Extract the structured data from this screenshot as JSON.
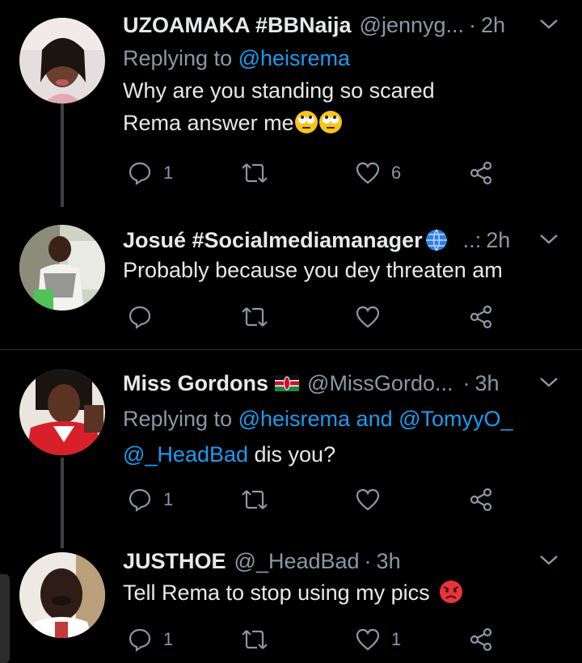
{
  "tweets": [
    {
      "name": "UZOAMAKA #BBNaija",
      "handle": "@jennyg...",
      "time": "2h",
      "replying_prefix": "Replying to ",
      "replying_mentions": "@heisrema",
      "lines": [
        "Why are you standing so scared",
        "Rema answer me"
      ],
      "emoji": [
        "face-with-rolling-eyes",
        "face-with-rolling-eyes"
      ],
      "reply_count": "1",
      "retweet_count": "",
      "like_count": "6"
    },
    {
      "name": "Josué #Socialmediamanager",
      "name_emoji": "globe",
      "handle": "..",
      "time": "2h",
      "lines": [
        "Probably because you dey threaten am"
      ],
      "reply_count": "",
      "retweet_count": "",
      "like_count": ""
    },
    {
      "name": "Miss Gordons",
      "name_emoji": "kenya-flag",
      "handle": "@MissGordo...",
      "time": "3h",
      "replying_prefix": "Replying to ",
      "replying_mentions": "@heisrema and @TomyyO_",
      "text_mention": "@_HeadBad",
      "text_rest": " dis you?",
      "reply_count": "1",
      "retweet_count": "",
      "like_count": ""
    },
    {
      "name": "JUSTHOE",
      "handle": "@_HeadBad",
      "time": "3h",
      "lines": [
        "Tell Rema to stop using my pics"
      ],
      "emoji": [
        "pouting-face"
      ],
      "reply_count": "1",
      "retweet_count": "",
      "like_count": "1"
    }
  ],
  "colors": {
    "background": "#000000",
    "name": "#e7e9ea",
    "secondary": "#8b98a5",
    "mention": "#1d9bf0",
    "thread_line": "#3d4044"
  }
}
